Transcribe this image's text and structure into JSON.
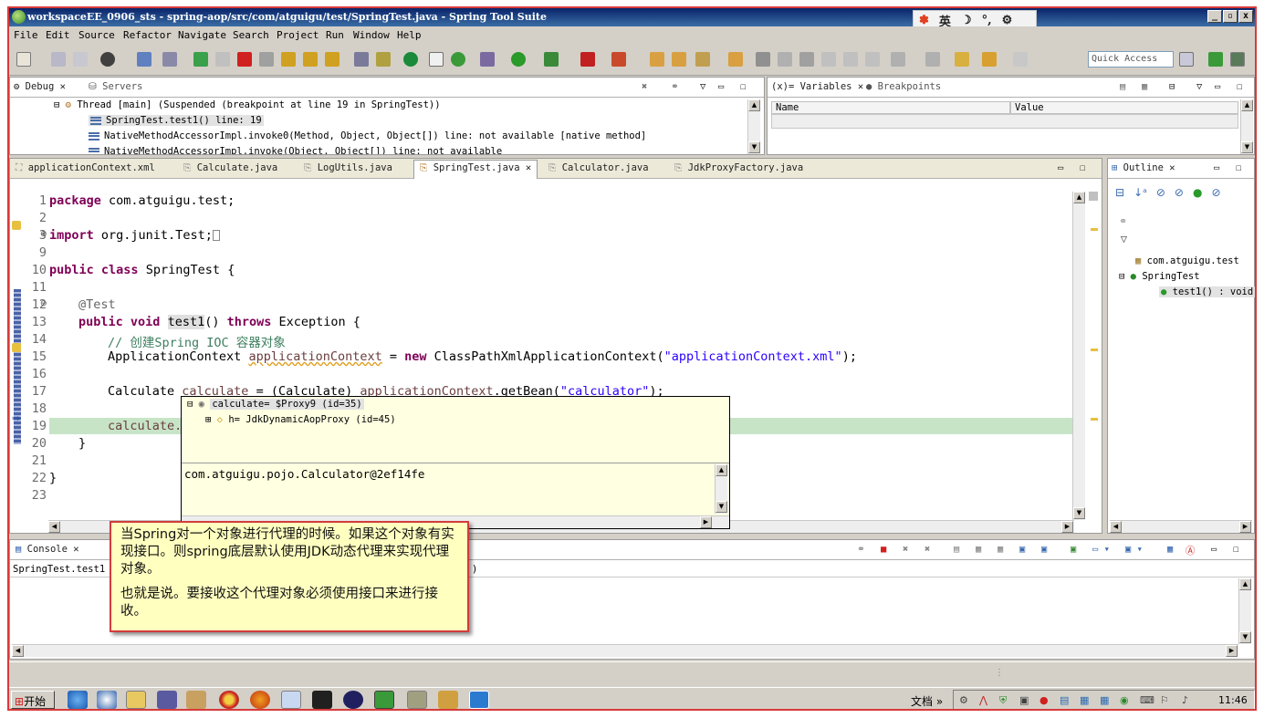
{
  "window": {
    "title": "workspaceEE_0906_sts - spring-aop/src/com/atguigu/test/SpringTest.java - Spring Tool Suite",
    "ime_label": "英"
  },
  "menu": [
    "File",
    "Edit",
    "Source",
    "Refactor",
    "Navigate",
    "Search",
    "Project",
    "Run",
    "Window",
    "Help"
  ],
  "toolbar": {
    "quick_access_placeholder": "Quick Access"
  },
  "debug_view": {
    "tabs": [
      "Debug",
      "Servers"
    ],
    "thread": "Thread [main] (Suspended (breakpoint at line 19 in SpringTest))",
    "frames": [
      "SpringTest.test1() line: 19",
      "NativeMethodAccessorImpl.invoke0(Method, Object, Object[]) line: not available [native method]",
      "NativeMethodAccessorImpl.invoke(Object, Object[]) line: not available"
    ]
  },
  "variables_view": {
    "tabs": [
      "Variables",
      "Breakpoints"
    ],
    "columns": [
      "Name",
      "Value"
    ]
  },
  "editor": {
    "tabs": [
      "applicationContext.xml",
      "Calculate.java",
      "LogUtils.java",
      "SpringTest.java",
      "Calculator.java",
      "JdkProxyFactory.java"
    ],
    "active_tab": "SpringTest.java",
    "line_numbers": [
      "1",
      "2",
      "3",
      "9",
      "10",
      "11",
      "12",
      "13",
      "14",
      "15",
      "16",
      "17",
      "18",
      "19",
      "20",
      "21",
      "22",
      "23"
    ],
    "lines": {
      "l1_kw": "package",
      "l1_rest": " com.atguigu.test;",
      "l3_kw": "import",
      "l3_rest": " org.junit.Test;",
      "l10_kw1": "public",
      "l10_kw2": " class",
      "l10_rest": " SpringTest {",
      "l12_ann": "@Test",
      "l13_kw1": "public",
      "l13_kw2": " void",
      "l13_method": "test1",
      "l13_mid": "() ",
      "l13_kw3": "throws",
      "l13_rest": " Exception {",
      "l14_comment": "// 创建Spring IOC 容器对象",
      "l15_type": "ApplicationContext ",
      "l15_var": "applicationContext",
      "l15_eq": " = ",
      "l15_new": "new",
      "l15_ctor": " ClassPathXmlApplicationContext(",
      "l15_str": "\"applicationContext.xml\"",
      "l15_end": ");",
      "l17_type": "Calculate ",
      "l17_var": "calculate",
      "l17_mid": " = (Calculate) ",
      "l17_ctx": "applicationContext",
      "l17_call": ".getBean(",
      "l17_str": "\"calculator\"",
      "l17_end": ");",
      "l19_var": "calculate.",
      "l20": "}",
      "l22": "}"
    }
  },
  "hover_popup": {
    "root": "calculate= $Proxy9  (id=35)",
    "child": "h= JdkDynamicAopProxy  (id=45)",
    "detail": "com.atguigu.pojo.Calculator@2ef14fe"
  },
  "outline_view": {
    "tab": "Outline",
    "package": "com.atguigu.test",
    "class": "SpringTest",
    "method": "test1() : void"
  },
  "console_view": {
    "tab": "Console",
    "launch_prefix": "SpringTest.test1",
    "launch_suffix": ")"
  },
  "annotation": {
    "para1": "当Spring对一个对象进行代理的时候。如果这个对象有实现接口。则spring底层默认使用JDK动态代理来实现代理对象。",
    "para2": "也就是说。要接收这个代理对象必须使用接口来进行接收。"
  },
  "taskbar": {
    "start": "开始",
    "docs": "文档",
    "clock": "11:46"
  },
  "colors": {
    "keyword": "#7f0055",
    "string": "#2a00ff",
    "comment": "#3f7f5f",
    "field": "#6a3e3e",
    "current_line": "#c7e4c7",
    "frame_accent": "#d83a3a"
  }
}
